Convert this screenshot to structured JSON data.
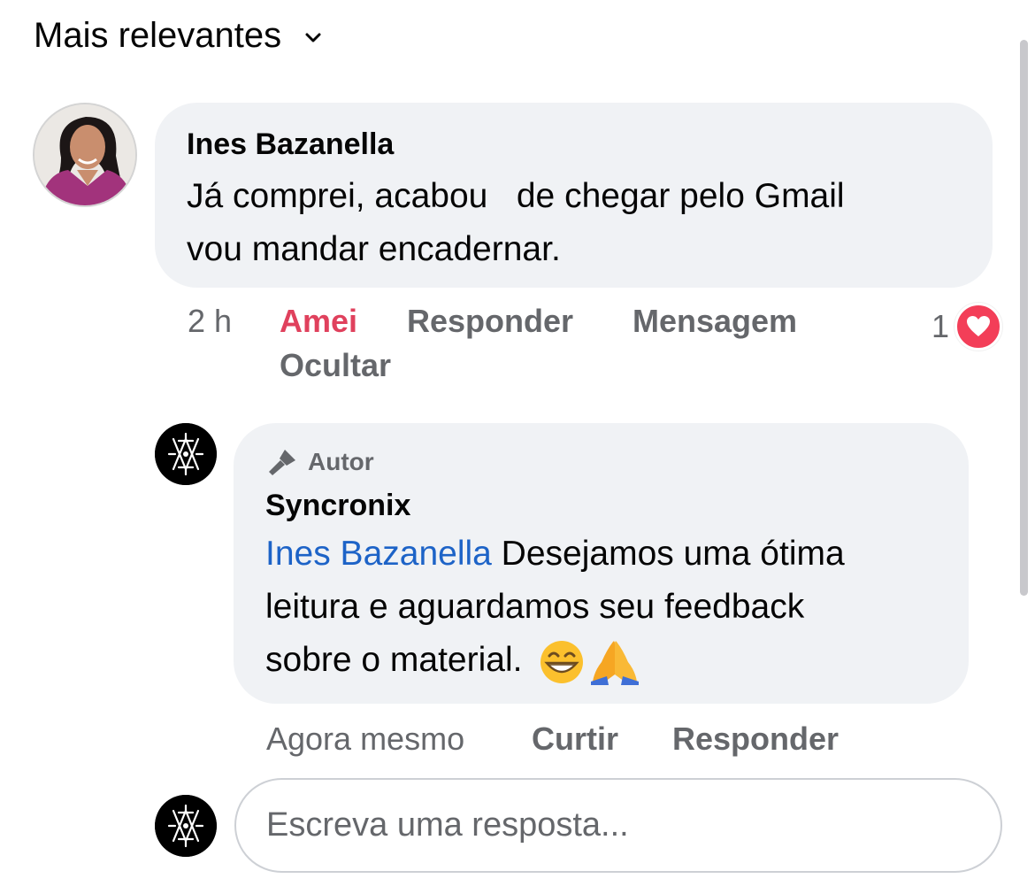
{
  "sort": {
    "label": "Mais relevantes",
    "icon": "chevron-down-icon"
  },
  "comment": {
    "author": "Ines Bazanella",
    "text_line1": "Já comprei, acabou   de chegar pelo Gmail",
    "text_line2": "vou mandar encadernar.",
    "time": "2 h",
    "actions": {
      "love": "Amei",
      "reply": "Responder",
      "message": "Mensagem",
      "hide": "Ocultar"
    },
    "reaction_count": "1",
    "reaction_icon": "heart-icon",
    "colors": {
      "love": "#e0415d",
      "heart_badge": "#f33e58"
    }
  },
  "reply": {
    "badge": "Autor",
    "badge_icon": "microphone-icon",
    "author": "Syncronix",
    "mention": "Ines Bazanella",
    "text_line1": " Desejamos uma ótima",
    "text_line2": "leitura e aguardamos seu feedback",
    "text_line3": "sobre o material.",
    "emojis": [
      "grinning-face-emoji",
      "folded-hands-emoji"
    ],
    "time": "Agora mesmo",
    "actions": {
      "like": "Curtir",
      "reply": "Responder"
    },
    "colors": {
      "mention": "#1d63c7"
    }
  },
  "composer": {
    "placeholder": "Escreva uma resposta..."
  }
}
